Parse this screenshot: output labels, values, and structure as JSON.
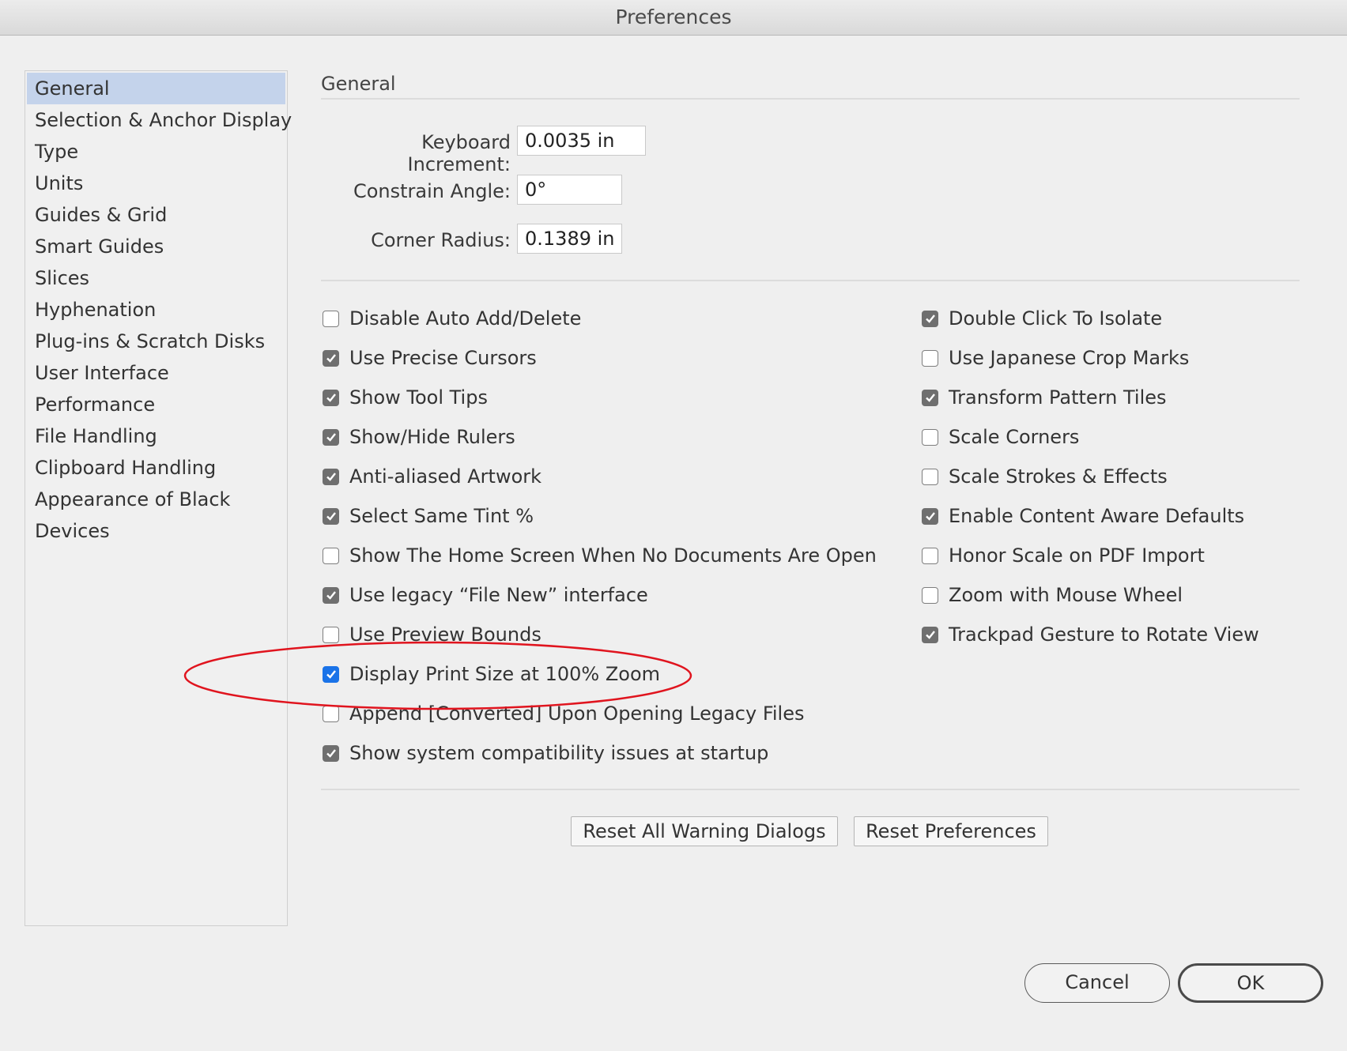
{
  "window": {
    "title": "Preferences"
  },
  "sidebar": {
    "items": [
      {
        "label": "General",
        "selected": true
      },
      {
        "label": "Selection & Anchor Display"
      },
      {
        "label": "Type"
      },
      {
        "label": "Units"
      },
      {
        "label": "Guides & Grid"
      },
      {
        "label": "Smart Guides"
      },
      {
        "label": "Slices"
      },
      {
        "label": "Hyphenation"
      },
      {
        "label": "Plug-ins & Scratch Disks"
      },
      {
        "label": "User Interface"
      },
      {
        "label": "Performance"
      },
      {
        "label": "File Handling"
      },
      {
        "label": "Clipboard Handling"
      },
      {
        "label": "Appearance of Black"
      },
      {
        "label": "Devices"
      }
    ]
  },
  "general": {
    "title": "General",
    "fields": {
      "keyboard_increment": {
        "label": "Keyboard Increment:",
        "value": "0.0035 in"
      },
      "constrain_angle": {
        "label": "Constrain Angle:",
        "value": "0°"
      },
      "corner_radius": {
        "label": "Corner Radius:",
        "value": "0.1389 in"
      }
    },
    "left_checkboxes": [
      {
        "label": "Disable Auto Add/Delete",
        "checked": false
      },
      {
        "label": "Use Precise Cursors",
        "checked": true
      },
      {
        "label": "Show Tool Tips",
        "checked": true
      },
      {
        "label": "Show/Hide Rulers",
        "checked": true
      },
      {
        "label": "Anti-aliased Artwork",
        "checked": true
      },
      {
        "label": "Select Same Tint %",
        "checked": true
      },
      {
        "label": "Show The Home Screen When No Documents Are Open",
        "checked": false
      },
      {
        "label": "Use legacy “File New” interface",
        "checked": true
      },
      {
        "label": "Use Preview Bounds",
        "checked": false
      },
      {
        "label": "Display Print Size at 100% Zoom",
        "checked": true,
        "highlighted": true
      },
      {
        "label": "Append [Converted] Upon Opening Legacy Files",
        "checked": false
      },
      {
        "label": "Show system compatibility issues at startup",
        "checked": true
      }
    ],
    "right_checkboxes": [
      {
        "label": "Double Click To Isolate",
        "checked": true
      },
      {
        "label": "Use Japanese Crop Marks",
        "checked": false
      },
      {
        "label": "Transform Pattern Tiles",
        "checked": true
      },
      {
        "label": "Scale Corners",
        "checked": false
      },
      {
        "label": "Scale Strokes & Effects",
        "checked": false
      },
      {
        "label": "Enable Content Aware Defaults",
        "checked": true
      },
      {
        "label": "Honor Scale on PDF Import",
        "checked": false
      },
      {
        "label": "Zoom with Mouse Wheel",
        "checked": false
      },
      {
        "label": "Trackpad Gesture to Rotate View",
        "checked": true
      }
    ],
    "buttons": {
      "reset_warnings": "Reset All Warning Dialogs",
      "reset_preferences": "Reset Preferences"
    }
  },
  "footer": {
    "cancel": "Cancel",
    "ok": "OK"
  },
  "colors": {
    "accent": "#1a73e8",
    "selection": "#c4d3eb",
    "annotation": "#e0141e"
  }
}
